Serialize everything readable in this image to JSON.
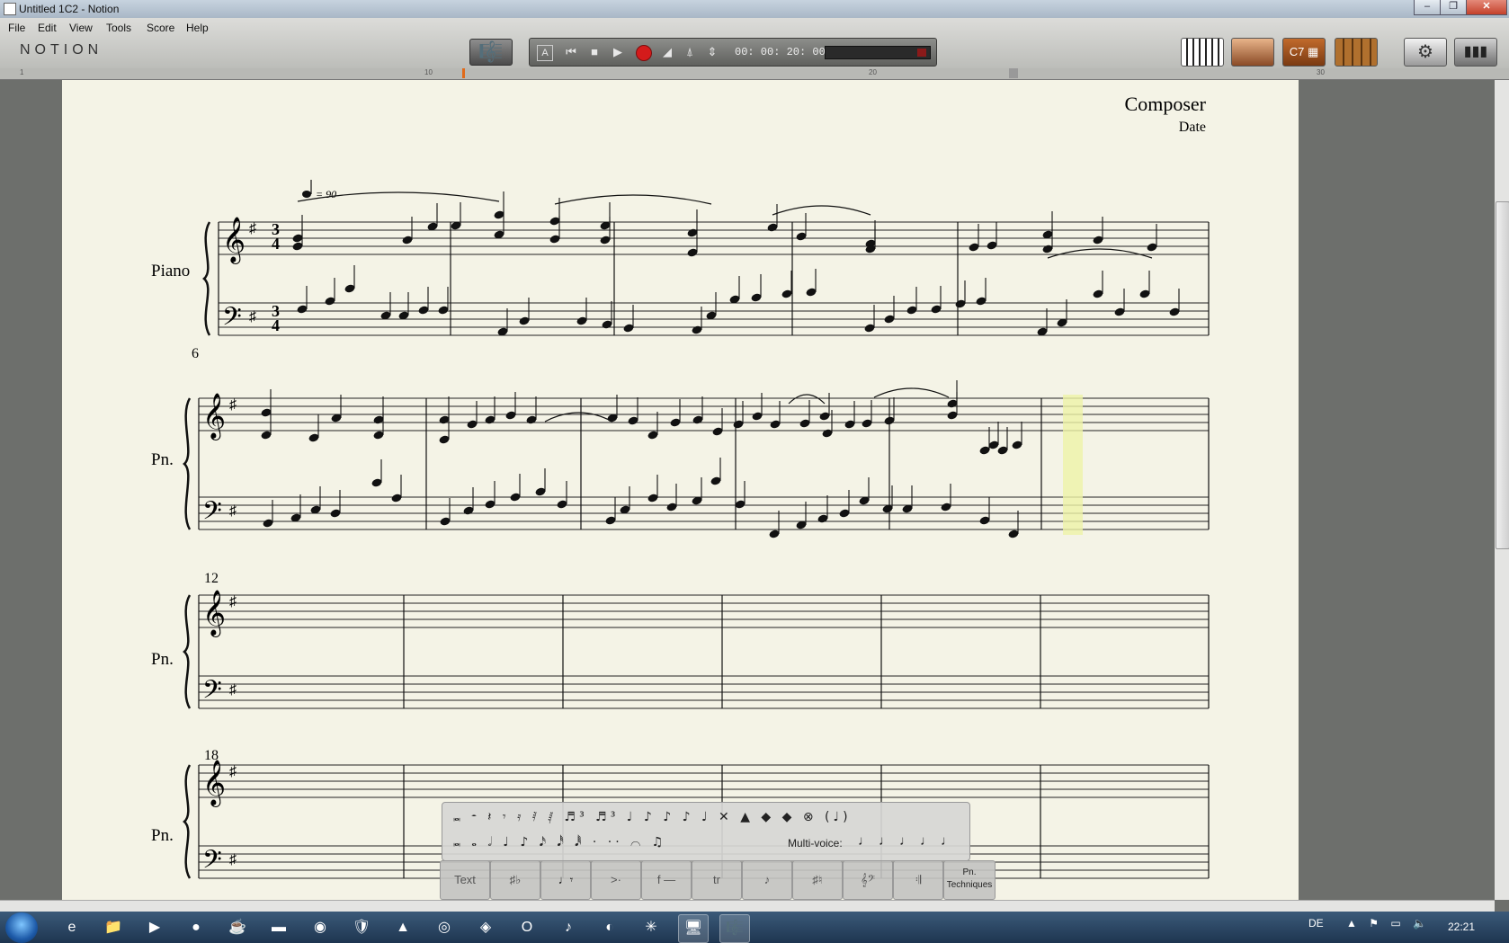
{
  "window": {
    "title": "Untitled 1C2 - Notion",
    "minimize": "‒",
    "restore": "❐",
    "close": "✕"
  },
  "menu": [
    {
      "label": "File"
    },
    {
      "label": "Edit"
    },
    {
      "label": "View"
    },
    {
      "label": "Tools"
    },
    {
      "label": "Score"
    },
    {
      "label": "Help"
    }
  ],
  "logo": "NOTION",
  "transport": {
    "time": "00: 00: 20: 00",
    "rewind": "⏮",
    "stop": "■",
    "play": "▶",
    "up_down": "⇕",
    "a": "A"
  },
  "ruler": {
    "marks": [
      "1",
      "10",
      "20",
      "30"
    ]
  },
  "score": {
    "composer": "Composer",
    "date": "Date",
    "tempo": "= 90",
    "instrument_full": "Piano",
    "instrument_short": "Pn.",
    "measure_numbers": [
      "6",
      "12",
      "18"
    ],
    "time_sig_top": "3",
    "time_sig_bottom": "4"
  },
  "palette": {
    "row1": "𝅜 𝄼 𝄽 𝄾 𝄿 𝅀 𝅁 ♬³ ♬³ ♩ ♪ ♪ ♪ ♩ ✕ ▲ ◆ ◆ ⊗ (♩)",
    "row2": "𝅜 𝅝 𝅗𝅥 ♩ ♪ 𝅘𝅥𝅯 𝅘𝅥𝅰 𝅘𝅥𝅱 · ·· ⌒ ♫",
    "multivoice_label": "Multi-voice:",
    "tabs": [
      {
        "label": "Text"
      },
      {
        "label": "♯♭"
      },
      {
        "label": "♩𝄾"
      },
      {
        "label": ">·"
      },
      {
        "label": "f —"
      },
      {
        "label": "tr"
      },
      {
        "label": "♪"
      },
      {
        "label": "♯♮"
      },
      {
        "label": "𝄞𝄢"
      },
      {
        "label": "𝄇"
      },
      {
        "label": "Pn. Techniques"
      }
    ]
  },
  "taskbar": {
    "apps": [
      "e",
      "📁",
      "▶",
      "●",
      "☕",
      "▬",
      "◉",
      "🛡",
      "▲",
      "◎",
      "◈",
      "O",
      "♪",
      "◐",
      "✳",
      "🖥",
      "🎼"
    ],
    "lang": "DE",
    "clock": "22:21"
  },
  "colors": {
    "paper": "#f4f3e6",
    "highlight": "#eef2a8",
    "record": "#d41b1b"
  }
}
